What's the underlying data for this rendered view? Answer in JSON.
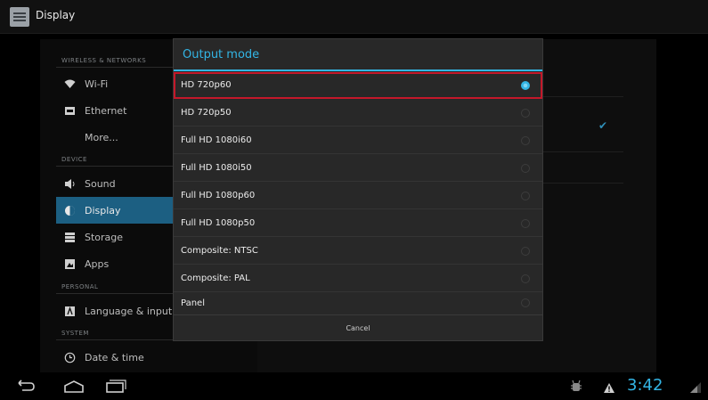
{
  "actionbar": {
    "title": "Display",
    "icon": "display-settings-icon"
  },
  "nav": {
    "sections": {
      "wireless": "WIRELESS & NETWORKS",
      "device": "DEVICE",
      "personal": "PERSONAL",
      "system": "SYSTEM"
    },
    "items": [
      {
        "label": "Wi-Fi",
        "icon": "wifi-icon"
      },
      {
        "label": "Ethernet",
        "icon": "ethernet-icon"
      },
      {
        "label": "More...",
        "icon": ""
      },
      {
        "label": "Sound",
        "icon": "speaker-icon"
      },
      {
        "label": "Display",
        "icon": "brightness-icon",
        "selected": true
      },
      {
        "label": "Storage",
        "icon": "storage-icon"
      },
      {
        "label": "Apps",
        "icon": "apps-icon"
      },
      {
        "label": "Language & input",
        "icon": "language-icon"
      },
      {
        "label": "Date & time",
        "icon": "clock-icon"
      }
    ]
  },
  "dialog": {
    "title": "Output mode",
    "options": [
      {
        "label": "HD 720p60",
        "selected": true
      },
      {
        "label": "HD 720p50",
        "selected": false
      },
      {
        "label": "Full HD 1080i60",
        "selected": false
      },
      {
        "label": "Full HD 1080i50",
        "selected": false
      },
      {
        "label": "Full HD 1080p60",
        "selected": false
      },
      {
        "label": "Full HD 1080p50",
        "selected": false
      },
      {
        "label": "Composite: NTSC",
        "selected": false
      },
      {
        "label": "Composite: PAL",
        "selected": false
      },
      {
        "label": "Panel",
        "selected": false
      }
    ],
    "cancel_label": "Cancel"
  },
  "statusbar": {
    "time": "3:42"
  },
  "colors": {
    "accent": "#33b5e5",
    "highlight": "#c4182a",
    "selected_nav": "#1c5f82"
  }
}
